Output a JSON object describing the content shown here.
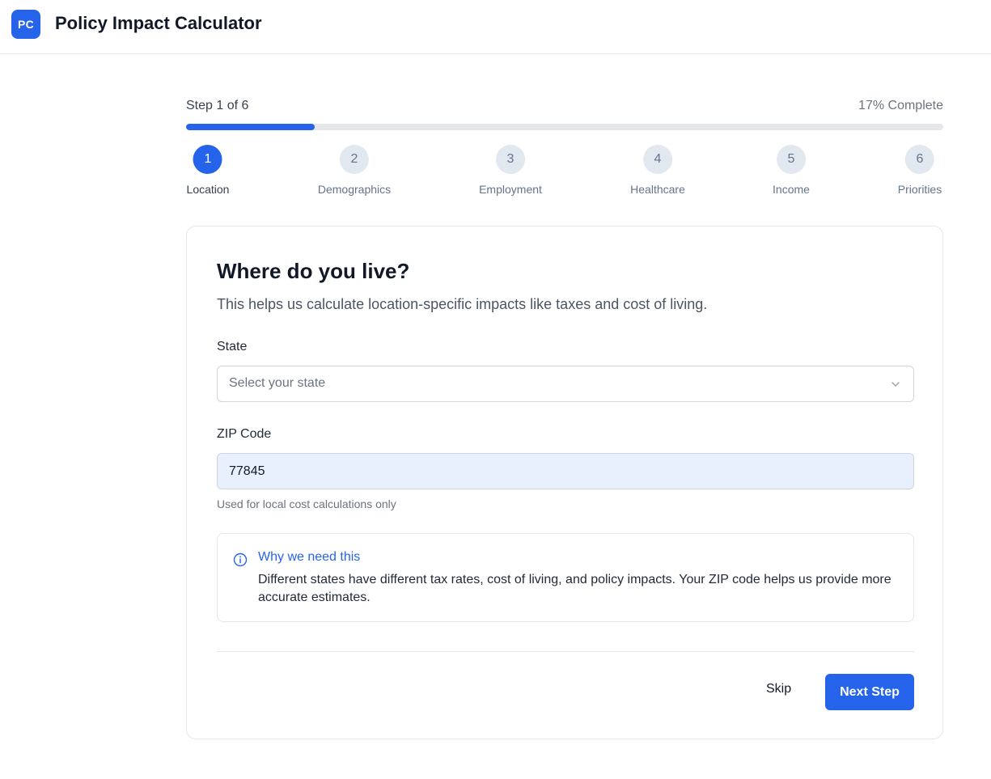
{
  "app": {
    "logo_text": "PC",
    "title": "Policy Impact Calculator",
    "accent_color": "#2563eb"
  },
  "progress": {
    "step_text": "Step 1 of 6",
    "percent_text": "17% Complete",
    "percent": 17
  },
  "steps": [
    {
      "number": "1",
      "label": "Location",
      "active": true
    },
    {
      "number": "2",
      "label": "Demographics",
      "active": false
    },
    {
      "number": "3",
      "label": "Employment",
      "active": false
    },
    {
      "number": "4",
      "label": "Healthcare",
      "active": false
    },
    {
      "number": "5",
      "label": "Income",
      "active": false
    },
    {
      "number": "6",
      "label": "Priorities",
      "active": false
    }
  ],
  "form": {
    "title": "Where do you live?",
    "subtitle": "This helps us calculate location-specific impacts like taxes and cost of living.",
    "state_label": "State",
    "state_placeholder": "Select your state",
    "zip_label": "ZIP Code",
    "zip_value": "77845",
    "zip_hint": "Used for local cost calculations only"
  },
  "info": {
    "icon": "info-icon",
    "title": "Why we need this",
    "body": "Different states have different tax rates, cost of living, and policy impacts. Your ZIP code helps us provide more accurate estimates."
  },
  "actions": {
    "skip_label": "Skip",
    "next_label": "Next Step"
  }
}
